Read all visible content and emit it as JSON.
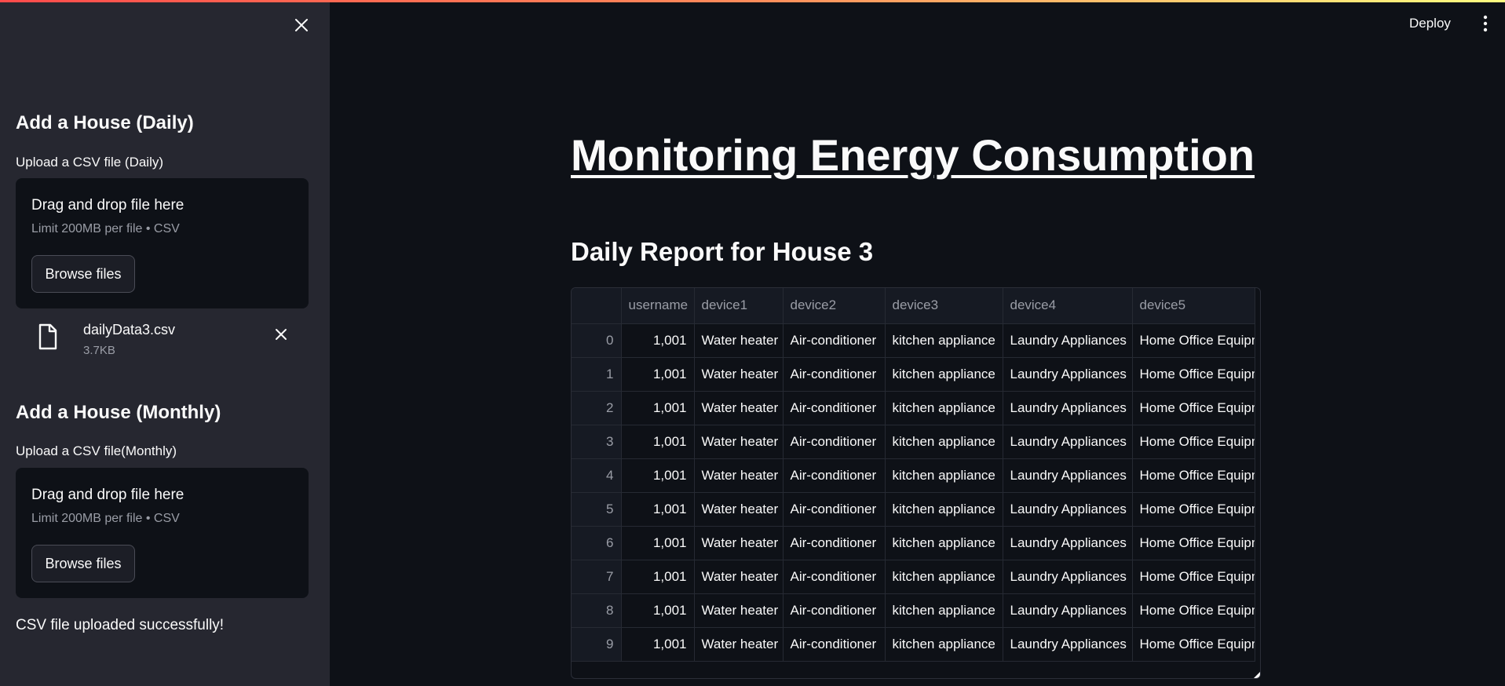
{
  "header": {
    "deploy_label": "Deploy"
  },
  "sidebar": {
    "daily": {
      "title": "Add a House (Daily)",
      "upload_label": "Upload a CSV file (Daily)",
      "drop_title": "Drag and drop file here",
      "drop_limit": "Limit 200MB per file • CSV",
      "browse_label": "Browse files"
    },
    "uploaded_file": {
      "name": "dailyData3.csv",
      "size": "3.7KB"
    },
    "monthly": {
      "title": "Add a House (Monthly)",
      "upload_label": "Upload a CSV file(Monthly)",
      "drop_title": "Drag and drop file here",
      "drop_limit": "Limit 200MB per file • CSV",
      "browse_label": "Browse files"
    },
    "success_message": "CSV file uploaded successfully!"
  },
  "main": {
    "title": "Monitoring Energy Consumption",
    "report_title": "Daily Report for House 3",
    "table": {
      "columns": [
        "",
        "username",
        "device1",
        "device2",
        "device3",
        "device4",
        "device5"
      ],
      "rows": [
        [
          "0",
          "1,001",
          "Water heater",
          "Air-conditioner",
          "kitchen appliance",
          "Laundry Appliances",
          "Home Office Equipm"
        ],
        [
          "1",
          "1,001",
          "Water heater",
          "Air-conditioner",
          "kitchen appliance",
          "Laundry Appliances",
          "Home Office Equipm"
        ],
        [
          "2",
          "1,001",
          "Water heater",
          "Air-conditioner",
          "kitchen appliance",
          "Laundry Appliances",
          "Home Office Equipm"
        ],
        [
          "3",
          "1,001",
          "Water heater",
          "Air-conditioner",
          "kitchen appliance",
          "Laundry Appliances",
          "Home Office Equipm"
        ],
        [
          "4",
          "1,001",
          "Water heater",
          "Air-conditioner",
          "kitchen appliance",
          "Laundry Appliances",
          "Home Office Equipm"
        ],
        [
          "5",
          "1,001",
          "Water heater",
          "Air-conditioner",
          "kitchen appliance",
          "Laundry Appliances",
          "Home Office Equipm"
        ],
        [
          "6",
          "1,001",
          "Water heater",
          "Air-conditioner",
          "kitchen appliance",
          "Laundry Appliances",
          "Home Office Equipm"
        ],
        [
          "7",
          "1,001",
          "Water heater",
          "Air-conditioner",
          "kitchen appliance",
          "Laundry Appliances",
          "Home Office Equipm"
        ],
        [
          "8",
          "1,001",
          "Water heater",
          "Air-conditioner",
          "kitchen appliance",
          "Laundry Appliances",
          "Home Office Equipm"
        ],
        [
          "9",
          "1,001",
          "Water heater",
          "Air-conditioner",
          "kitchen appliance",
          "Laundry Appliances",
          "Home Office Equipm"
        ]
      ]
    }
  },
  "icons": {
    "sidebar_close": "close-icon",
    "file": "file-icon",
    "file_remove": "close-icon",
    "menu": "vertical-dots-icon"
  },
  "colors": {
    "background": "#0e1117",
    "sidebar": "#262730",
    "accent_gradient_start": "#ff4b4b",
    "accent_gradient_end": "#fffd80"
  }
}
